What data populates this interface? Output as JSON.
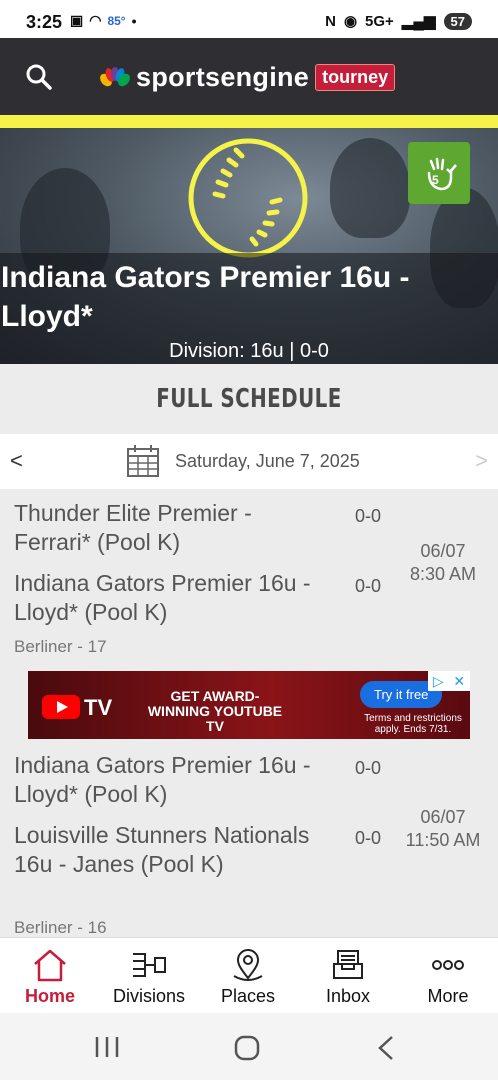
{
  "status_bar": {
    "time": "3:25",
    "temperature": "85°",
    "network": "5G+",
    "battery": "57"
  },
  "header": {
    "brand": "sportsengine",
    "brand_badge": "tourney",
    "search_icon": "search-icon"
  },
  "hero": {
    "team_title": "Indiana Gators Premier 16u - Lloyd*",
    "division": "Division: 16u | 0-0",
    "badge_icon": "hand-five-check-icon"
  },
  "schedule": {
    "heading": "FULL SCHEDULE",
    "prev": "<",
    "next": ">",
    "date": "Saturday, June 7, 2025"
  },
  "games": [
    {
      "home": "Thunder Elite Premier - Ferrari* (Pool K)",
      "home_score": "0-0",
      "away": "Indiana Gators Premier 16u - Lloyd* (Pool K)",
      "away_score": "0-0",
      "date": "06/07",
      "time": "8:30 AM",
      "venue": "Berliner - 17"
    },
    {
      "home": "Indiana Gators Premier 16u - Lloyd* (Pool K)",
      "home_score": "0-0",
      "away": "Louisville Stunners Nationals 16u - Janes (Pool K)",
      "away_score": "0-0",
      "date": "06/07",
      "time": "11:50 AM",
      "venue": "Berliner - 16"
    }
  ],
  "ad": {
    "brand": "TV",
    "headline": "GET AWARD-WINNING YOUTUBE TV",
    "cta": "Try it free",
    "terms": "Terms and restrictions apply. Ends 7/31."
  },
  "nav": {
    "items": [
      {
        "label": "Home",
        "icon": "home-icon"
      },
      {
        "label": "Divisions",
        "icon": "bracket-icon"
      },
      {
        "label": "Places",
        "icon": "map-pin-icon"
      },
      {
        "label": "Inbox",
        "icon": "inbox-icon"
      },
      {
        "label": "More",
        "icon": "more-icon"
      }
    ]
  },
  "colors": {
    "accent": "#c41e3a",
    "header_bg": "#2f2f33",
    "yellow": "#f5f24a",
    "badge_green": "#5ea832"
  }
}
